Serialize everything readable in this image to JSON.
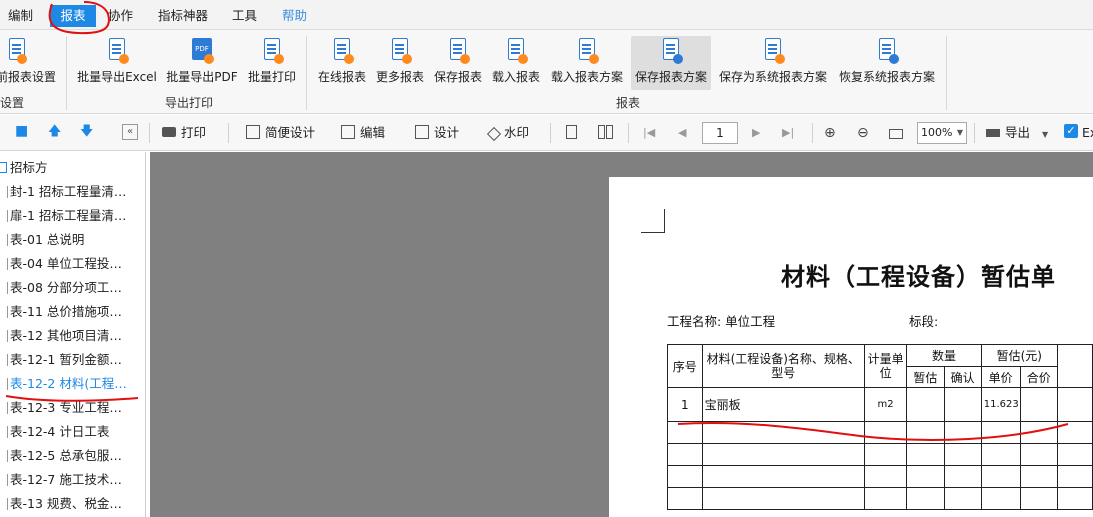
{
  "menu": {
    "items": [
      "编制",
      "报表",
      "协作",
      "指标神器",
      "工具",
      "帮助"
    ]
  },
  "ribbon": {
    "buttons": {
      "set_report": "前报表设置",
      "export_excel": "批量导出Excel",
      "export_pdf": "批量导出PDF",
      "batch_print": "批量打印",
      "online_report": "在线报表",
      "more_report": "更多报表",
      "save_report": "保存报表",
      "load_report": "载入报表",
      "load_scheme": "载入报表方案",
      "save_scheme": "保存报表方案",
      "save_system_scheme": "保存为系统报表方案",
      "restore_system_scheme": "恢复系统报表方案"
    },
    "groups": {
      "settings": "设置",
      "export_print": "导出打印",
      "report": "报表"
    }
  },
  "toolbar": {
    "print": "打印",
    "simple_design": "简便设计",
    "edit": "编辑",
    "design": "设计",
    "watermark": "水印",
    "page": "1",
    "zoom": "100%",
    "export": "导出",
    "excel_check": "Ex"
  },
  "sidebar": {
    "root": "招标方",
    "items": [
      "封-1 招标工程量清…",
      "扉-1 招标工程量清…",
      "表-01 总说明",
      "表-04 单位工程投…",
      "表-08 分部分项工…",
      "表-11 总价措施项…",
      "表-12 其他项目清…",
      "表-12-1 暂列金额…",
      "表-12-2 材料(工程…",
      "表-12-3 专业工程…",
      "表-12-4 计日工表",
      "表-12-5 总承包服…",
      "表-12-7 施工技术…",
      "表-13 规费、税金…"
    ],
    "active_index": 8
  },
  "report": {
    "title": "材料（工程设备）暂估单",
    "project_label": "工程名称: 单位工程",
    "section_label": "标段:",
    "headers": {
      "seq": "序号",
      "name": "材料(工程设备)名称、规格、型号",
      "unit": "计量单位",
      "qty": "数量",
      "qty_est": "暂估",
      "qty_confirm": "确认",
      "est": "暂估(元)",
      "unit_price": "单价",
      "total": "合价"
    },
    "rows": [
      {
        "seq": "1",
        "name": "宝丽板",
        "unit": "m2",
        "unit_price": "11.623"
      }
    ]
  }
}
